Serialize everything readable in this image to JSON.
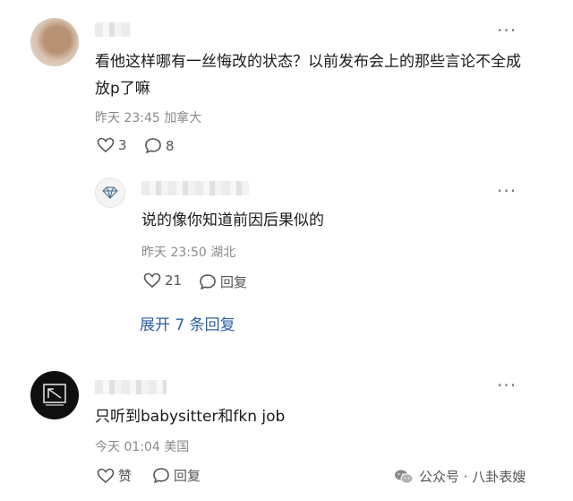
{
  "comments": [
    {
      "text": "看他这样哪有一丝悔改的状态？以前发布会上的那些言论不全成放p了嘛",
      "time": "昨天 23:45",
      "location": "加拿大",
      "likes": "3",
      "replies_count": "8"
    },
    {
      "text": "只听到babysitter和fkn job",
      "time": "今天 01:04",
      "location": "美国",
      "like_label": "赞",
      "reply_label": "回复"
    }
  ],
  "reply": {
    "text": "说的像你知道前因后果似的",
    "time": "昨天 23:50",
    "location": "湖北",
    "likes": "21",
    "reply_label": "回复"
  },
  "expand_label": "展开 7 条回复",
  "watermark": "公众号 · 八卦表嫂",
  "colors": {
    "link": "#2d5fa6",
    "meta": "#8a8a8a"
  },
  "icons": [
    "heart-icon",
    "comment-icon",
    "diamond-icon",
    "more-icon",
    "wechat-icon"
  ]
}
